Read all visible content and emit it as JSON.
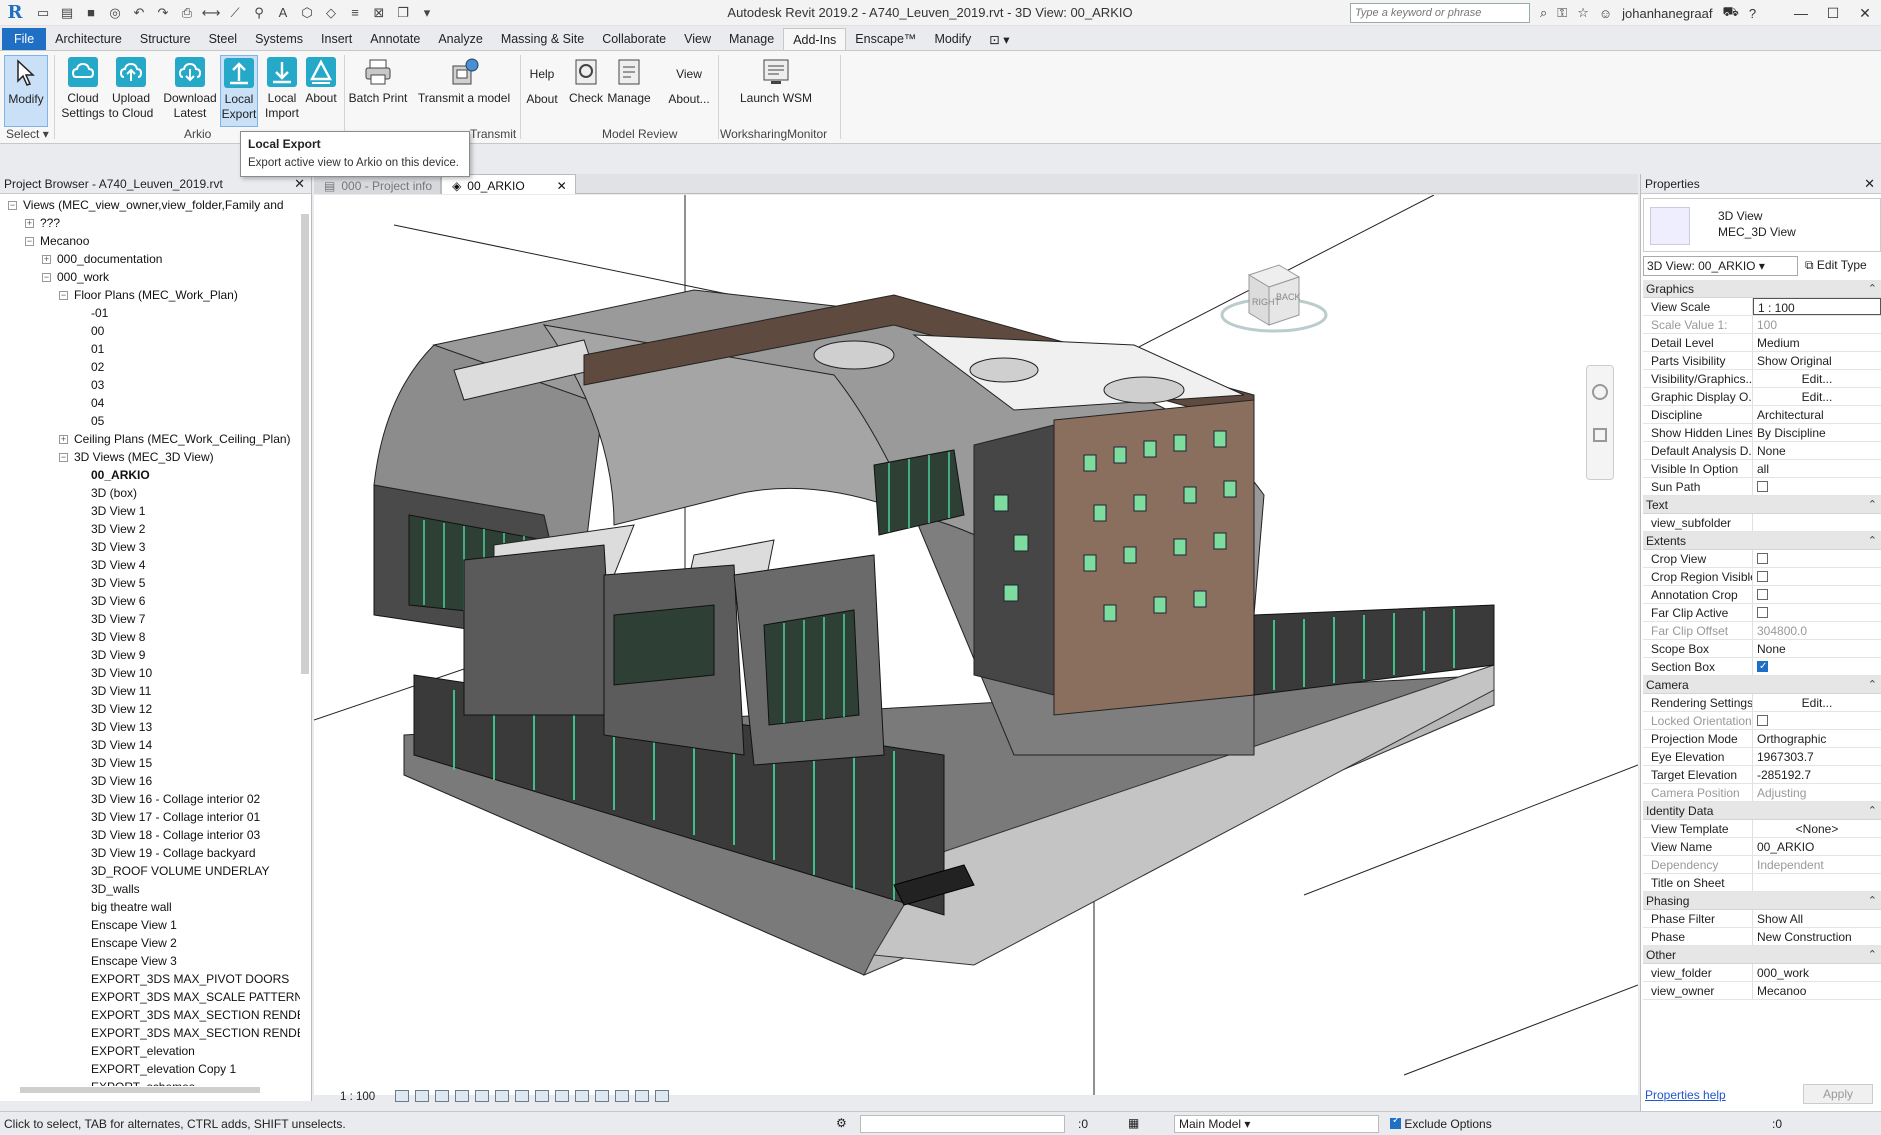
{
  "window": {
    "title": "Autodesk Revit 2019.2 - A740_Leuven_2019.rvt - 3D View: 00_ARKIO",
    "search_placeholder": "Type a keyword or phrase",
    "user": "johanhanegraaf"
  },
  "tabs": [
    "File",
    "Architecture",
    "Structure",
    "Steel",
    "Systems",
    "Insert",
    "Annotate",
    "Analyze",
    "Massing & Site",
    "Collaborate",
    "View",
    "Manage",
    "Add-Ins",
    "Enscape™",
    "Modify"
  ],
  "active_tab": "Add-Ins",
  "ribbon": {
    "modify": "Modify",
    "select": "Select",
    "cloud_settings": [
      "Cloud",
      "Settings"
    ],
    "upload_cloud": [
      "Upload",
      "to Cloud"
    ],
    "download_latest": [
      "Download",
      "Latest"
    ],
    "local_export": [
      "Local",
      "Export"
    ],
    "local_import": [
      "Local",
      "Import"
    ],
    "about": "About",
    "arkio_panel": "Arkio",
    "batch_print": "Batch Print",
    "transmit": "Transmit a model",
    "transmit_panel": "Transmit",
    "help": "Help",
    "about2": "About",
    "check": "Check",
    "manage": "Manage",
    "view": "View",
    "about3": "About...",
    "model_review_panel": "Model Review",
    "launch_wsm": "Launch WSM",
    "wsm_panel": "WorksharingMonitor"
  },
  "tooltip": {
    "title": "Local Export",
    "desc": "Export active view to Arkio on this device."
  },
  "browser": {
    "title": "Project Browser - A740_Leuven_2019.rvt",
    "nodes": [
      {
        "t": "Views (MEC_view_owner,view_folder,Family and",
        "l": 0,
        "e": "−"
      },
      {
        "t": "???",
        "l": 1,
        "e": "+"
      },
      {
        "t": "Mecanoo",
        "l": 1,
        "e": "−"
      },
      {
        "t": "000_documentation",
        "l": 2,
        "e": "+"
      },
      {
        "t": "000_work",
        "l": 2,
        "e": "−"
      },
      {
        "t": "Floor Plans (MEC_Work_Plan)",
        "l": 3,
        "e": "−"
      },
      {
        "t": "-01",
        "l": 4
      },
      {
        "t": "00",
        "l": 4
      },
      {
        "t": "01",
        "l": 4
      },
      {
        "t": "02",
        "l": 4
      },
      {
        "t": "03",
        "l": 4
      },
      {
        "t": "04",
        "l": 4
      },
      {
        "t": "05",
        "l": 4
      },
      {
        "t": "Ceiling Plans (MEC_Work_Ceiling_Plan)",
        "l": 3,
        "e": "+"
      },
      {
        "t": "3D Views (MEC_3D View)",
        "l": 3,
        "e": "−"
      },
      {
        "t": "00_ARKIO",
        "l": 4,
        "b": true
      },
      {
        "t": "3D (box)",
        "l": 4
      },
      {
        "t": "3D View 1",
        "l": 4
      },
      {
        "t": "3D View 2",
        "l": 4
      },
      {
        "t": "3D View 3",
        "l": 4
      },
      {
        "t": "3D View 4",
        "l": 4
      },
      {
        "t": "3D View 5",
        "l": 4
      },
      {
        "t": "3D View 6",
        "l": 4
      },
      {
        "t": "3D View 7",
        "l": 4
      },
      {
        "t": "3D View 8",
        "l": 4
      },
      {
        "t": "3D View 9",
        "l": 4
      },
      {
        "t": "3D View 10",
        "l": 4
      },
      {
        "t": "3D View 11",
        "l": 4
      },
      {
        "t": "3D View 12",
        "l": 4
      },
      {
        "t": "3D View 13",
        "l": 4
      },
      {
        "t": "3D View 14",
        "l": 4
      },
      {
        "t": "3D View 15",
        "l": 4
      },
      {
        "t": "3D View 16",
        "l": 4
      },
      {
        "t": "3D View 16 - Collage interior 02",
        "l": 4
      },
      {
        "t": "3D View 17 - Collage interior 01",
        "l": 4
      },
      {
        "t": "3D View 18 - Collage interior 03",
        "l": 4
      },
      {
        "t": "3D View 19 - Collage backyard",
        "l": 4
      },
      {
        "t": "3D_ROOF VOLUME UNDERLAY",
        "l": 4
      },
      {
        "t": "3D_walls",
        "l": 4
      },
      {
        "t": "big theatre wall",
        "l": 4
      },
      {
        "t": "Enscape View 1",
        "l": 4
      },
      {
        "t": "Enscape View 2",
        "l": 4
      },
      {
        "t": "Enscape View 3",
        "l": 4
      },
      {
        "t": "EXPORT_3DS MAX_PIVOT DOORS",
        "l": 4
      },
      {
        "t": "EXPORT_3DS MAX_SCALE PATTERN",
        "l": 4
      },
      {
        "t": "EXPORT_3DS MAX_SECTION RENDE",
        "l": 4
      },
      {
        "t": "EXPORT_3DS MAX_SECTION RENDE",
        "l": 4
      },
      {
        "t": "EXPORT_elevation",
        "l": 4
      },
      {
        "t": "EXPORT_elevation Copy 1",
        "l": 4
      },
      {
        "t": "EXPORT_schemes",
        "l": 4
      }
    ]
  },
  "view_tabs": [
    {
      "label": "000 - Project info",
      "active": false
    },
    {
      "label": "00_ARKIO",
      "active": true
    }
  ],
  "view_scale": "1 : 100",
  "viewcube": {
    "right": "RIGHT",
    "back": "BACK"
  },
  "properties": {
    "title": "Properties",
    "type1": "3D View",
    "type2": "MEC_3D View",
    "instance": "3D View: 00_ARKIO",
    "edit_type": "Edit Type",
    "groups": [
      {
        "name": "Graphics",
        "rows": [
          {
            "n": "View Scale",
            "v": "1 : 100",
            "kind": "input"
          },
          {
            "n": "Scale Value    1:",
            "v": "100",
            "dim": true
          },
          {
            "n": "Detail Level",
            "v": "Medium"
          },
          {
            "n": "Parts Visibility",
            "v": "Show Original"
          },
          {
            "n": "Visibility/Graphics...",
            "v": "Edit...",
            "kind": "btn"
          },
          {
            "n": "Graphic Display O...",
            "v": "Edit...",
            "kind": "btn"
          },
          {
            "n": "Discipline",
            "v": "Architectural"
          },
          {
            "n": "Show Hidden Lines",
            "v": "By Discipline"
          },
          {
            "n": "Default Analysis D...",
            "v": "None"
          },
          {
            "n": "Visible In Option",
            "v": "all"
          },
          {
            "n": "Sun Path",
            "v": "",
            "kind": "cb"
          }
        ]
      },
      {
        "name": "Text",
        "rows": [
          {
            "n": "view_subfolder",
            "v": ""
          }
        ]
      },
      {
        "name": "Extents",
        "rows": [
          {
            "n": "Crop View",
            "v": "",
            "kind": "cb"
          },
          {
            "n": "Crop Region Visible",
            "v": "",
            "kind": "cb"
          },
          {
            "n": "Annotation Crop",
            "v": "",
            "kind": "cb"
          },
          {
            "n": "Far Clip Active",
            "v": "",
            "kind": "cb"
          },
          {
            "n": "Far Clip Offset",
            "v": "304800.0",
            "dim": true
          },
          {
            "n": "Scope Box",
            "v": "None"
          },
          {
            "n": "Section Box",
            "v": "",
            "kind": "cbon"
          }
        ]
      },
      {
        "name": "Camera",
        "rows": [
          {
            "n": "Rendering Settings",
            "v": "Edit...",
            "kind": "btn"
          },
          {
            "n": "Locked Orientation",
            "v": "",
            "kind": "cb",
            "dim": true
          },
          {
            "n": "Projection Mode",
            "v": "Orthographic"
          },
          {
            "n": "Eye Elevation",
            "v": "1967303.7"
          },
          {
            "n": "Target Elevation",
            "v": "-285192.7"
          },
          {
            "n": "Camera Position",
            "v": "Adjusting",
            "dim": true
          }
        ]
      },
      {
        "name": "Identity Data",
        "rows": [
          {
            "n": "View Template",
            "v": "<None>",
            "kind": "btn"
          },
          {
            "n": "View Name",
            "v": "00_ARKIO"
          },
          {
            "n": "Dependency",
            "v": "Independent",
            "dim": true
          },
          {
            "n": "Title on Sheet",
            "v": ""
          }
        ]
      },
      {
        "name": "Phasing",
        "rows": [
          {
            "n": "Phase Filter",
            "v": "Show All"
          },
          {
            "n": "Phase",
            "v": "New Construction"
          }
        ]
      },
      {
        "name": "Other",
        "rows": [
          {
            "n": "view_folder",
            "v": "000_work"
          },
          {
            "n": "view_owner",
            "v": "Mecanoo"
          }
        ]
      }
    ],
    "help": "Properties help",
    "apply": "Apply"
  },
  "status": {
    "text": "Click to select, TAB for alternates, CTRL adds, SHIFT unselects.",
    "zero1": ":0",
    "model": "Main Model",
    "exclude": "Exclude Options",
    "zero2": ":0"
  },
  "colors": {
    "accent": "#1f6fc5",
    "arkio_icon": "#26a8c9",
    "glass": "#3fbf8a",
    "roof": "#8c8c8c",
    "brick": "#8a6e5e"
  }
}
